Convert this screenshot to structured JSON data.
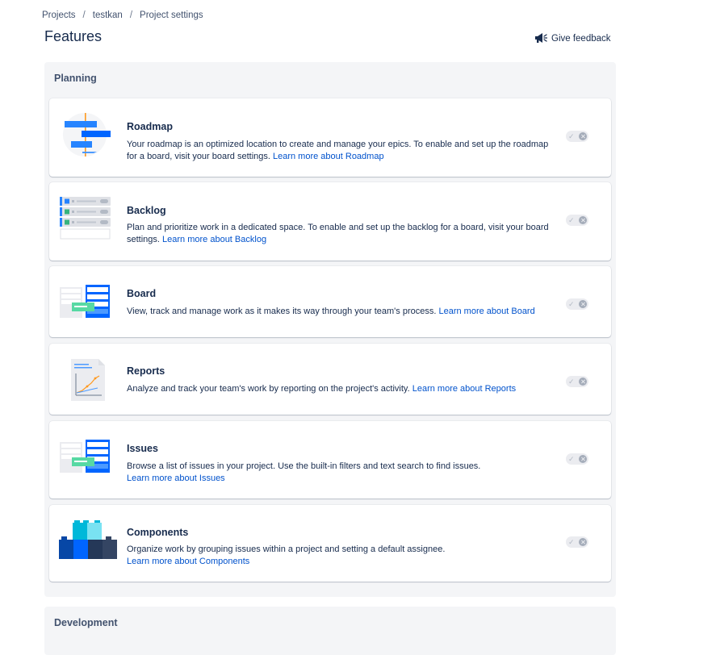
{
  "breadcrumb": {
    "items": [
      "Projects",
      "testkan",
      "Project settings"
    ],
    "separator": "/"
  },
  "page": {
    "title": "Features"
  },
  "feedback": {
    "label": "Give feedback",
    "icon": "megaphone-icon"
  },
  "colors": {
    "link": "#0052cc",
    "section_bg": "#f4f5f7",
    "text": "#172b4d",
    "toggle_off": "#ebecf0",
    "illustration_blue": "#2684ff",
    "illustration_green": "#57d9a3"
  },
  "sections": {
    "planning": {
      "title": "Planning",
      "features": {
        "roadmap": {
          "title": "Roadmap",
          "text": "Your roadmap is an optimized location to create and manage your epics. To enable and set up the roadmap for a board, visit your board settings. ",
          "link": "Learn more about Roadmap",
          "enabled": false
        },
        "backlog": {
          "title": "Backlog",
          "text": "Plan and prioritize work in a dedicated space. To enable and set up the backlog for a board, visit your board settings. ",
          "link": "Learn more about Backlog",
          "enabled": false
        },
        "board": {
          "title": "Board",
          "text": "View, track and manage work as it makes its way through your team's process. ",
          "link": "Learn more about Board",
          "enabled": false
        },
        "reports": {
          "title": "Reports",
          "text": "Analyze and track your team's work by reporting on the project's activity. ",
          "link": "Learn more about Reports",
          "enabled": false
        },
        "issues": {
          "title": "Issues",
          "text": "Browse a list of issues in your project. Use the built-in filters and text search to find issues.",
          "link": "Learn more about Issues",
          "enabled": false
        },
        "components": {
          "title": "Components",
          "text": "Organize work by grouping issues within a project and setting a default assignee.",
          "link": "Learn more about Components",
          "enabled": false
        }
      }
    },
    "development": {
      "title": "Development"
    }
  }
}
